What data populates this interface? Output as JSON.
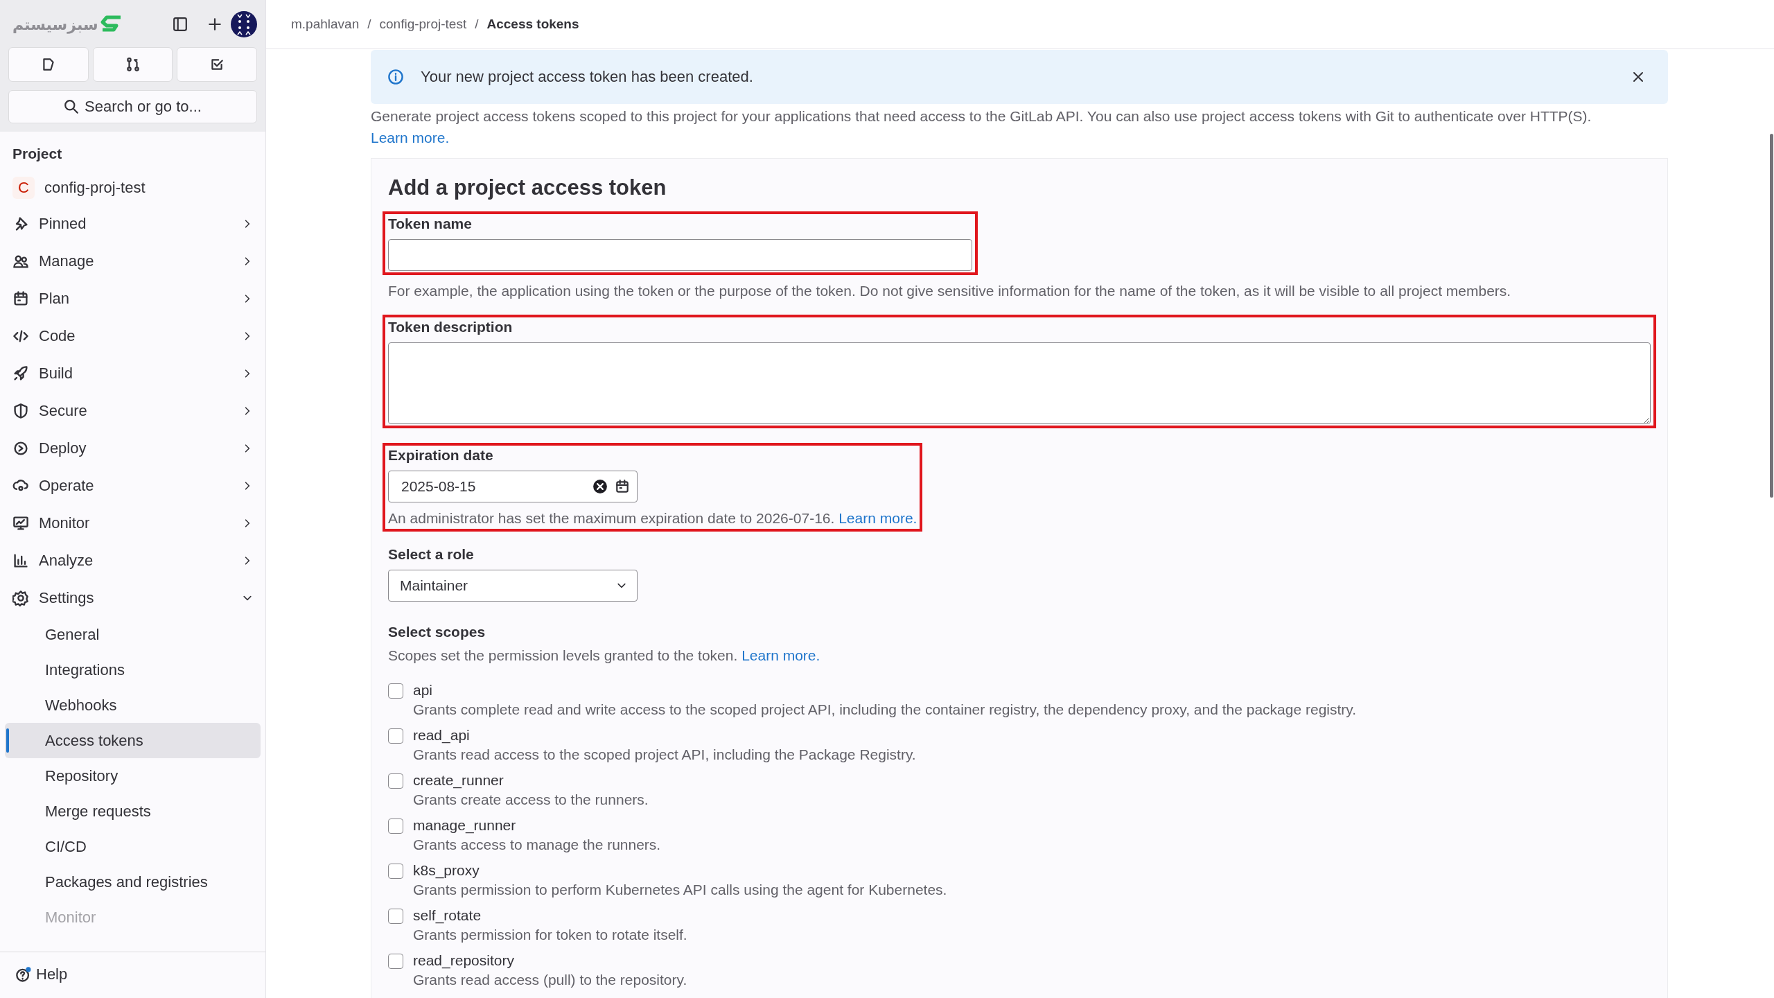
{
  "sidebar": {
    "logo_text": "سبزسیستم",
    "search": {
      "placeholder": "Search or go to..."
    },
    "section_title": "Project",
    "project": {
      "avatar_letter": "C",
      "name": "config-proj-test"
    },
    "items": [
      {
        "label": "Pinned",
        "expanded": false
      },
      {
        "label": "Manage",
        "expanded": false
      },
      {
        "label": "Plan",
        "expanded": false
      },
      {
        "label": "Code",
        "expanded": false
      },
      {
        "label": "Build",
        "expanded": false
      },
      {
        "label": "Secure",
        "expanded": false
      },
      {
        "label": "Deploy",
        "expanded": false
      },
      {
        "label": "Operate",
        "expanded": false
      },
      {
        "label": "Monitor",
        "expanded": false
      },
      {
        "label": "Analyze",
        "expanded": false
      },
      {
        "label": "Settings",
        "expanded": true,
        "children": [
          {
            "label": "General",
            "selected": false,
            "faded": false
          },
          {
            "label": "Integrations",
            "selected": false,
            "faded": false
          },
          {
            "label": "Webhooks",
            "selected": false,
            "faded": false
          },
          {
            "label": "Access tokens",
            "selected": true,
            "faded": false
          },
          {
            "label": "Repository",
            "selected": false,
            "faded": false
          },
          {
            "label": "Merge requests",
            "selected": false,
            "faded": false
          },
          {
            "label": "CI/CD",
            "selected": false,
            "faded": false
          },
          {
            "label": "Packages and registries",
            "selected": false,
            "faded": false
          },
          {
            "label": "Monitor",
            "selected": false,
            "faded": true
          }
        ]
      }
    ],
    "help": {
      "label": "Help",
      "notification": true
    }
  },
  "breadcrumbs": [
    {
      "label": "m.pahlavan",
      "current": false
    },
    {
      "separator": "/",
      "label": "config-proj-test",
      "current": false
    },
    {
      "separator": "/",
      "label": "Access tokens",
      "current": true
    }
  ],
  "alert": {
    "kind": "info",
    "message": "Your new project access token has been created."
  },
  "intro": {
    "text": "Generate project access tokens scoped to this project for your applications that need access to the GitLab API. You can also use project access tokens with Git to authenticate over HTTP(S).",
    "link": "Learn more."
  },
  "form": {
    "title": "Add a project access token",
    "fields": [
      {
        "kind": "text",
        "label": "Token name",
        "help": "For example, the application using the token or the purpose of the token. Do not give sensitive information for the name of the token, as it will be visible to all project members.",
        "highlighted": true,
        "help_highlighted": false
      },
      {
        "kind": "textarea",
        "label": "Token description",
        "highlighted": true
      },
      {
        "kind": "date",
        "label": "Expiration date",
        "value": "2025-08-15",
        "help": "An administrator has set the maximum expiration date to 2026-07-16.",
        "help_link": "Learn more.",
        "highlighted": true,
        "help_highlighted": true
      },
      {
        "kind": "select",
        "label": "Select a role",
        "value": "Maintainer"
      }
    ],
    "scopes": {
      "label": "Select scopes",
      "help": "Scopes set the permission levels granted to the token.",
      "help_link": "Learn more.",
      "items": [
        {
          "name": "api",
          "description": "Grants complete read and write access to the scoped project API, including the container registry, the dependency proxy, and the package registry.",
          "checked": false
        },
        {
          "name": "read_api",
          "description": "Grants read access to the scoped project API, including the Package Registry.",
          "checked": false
        },
        {
          "name": "create_runner",
          "description": "Grants create access to the runners.",
          "checked": false
        },
        {
          "name": "manage_runner",
          "description": "Grants access to manage the runners.",
          "checked": false
        },
        {
          "name": "k8s_proxy",
          "description": "Grants permission to perform Kubernetes API calls using the agent for Kubernetes.",
          "checked": false
        },
        {
          "name": "self_rotate",
          "description": "Grants permission for token to rotate itself.",
          "checked": false
        },
        {
          "name": "read_repository",
          "description": "Grants read access (pull) to the repository.",
          "checked": false
        }
      ]
    }
  }
}
